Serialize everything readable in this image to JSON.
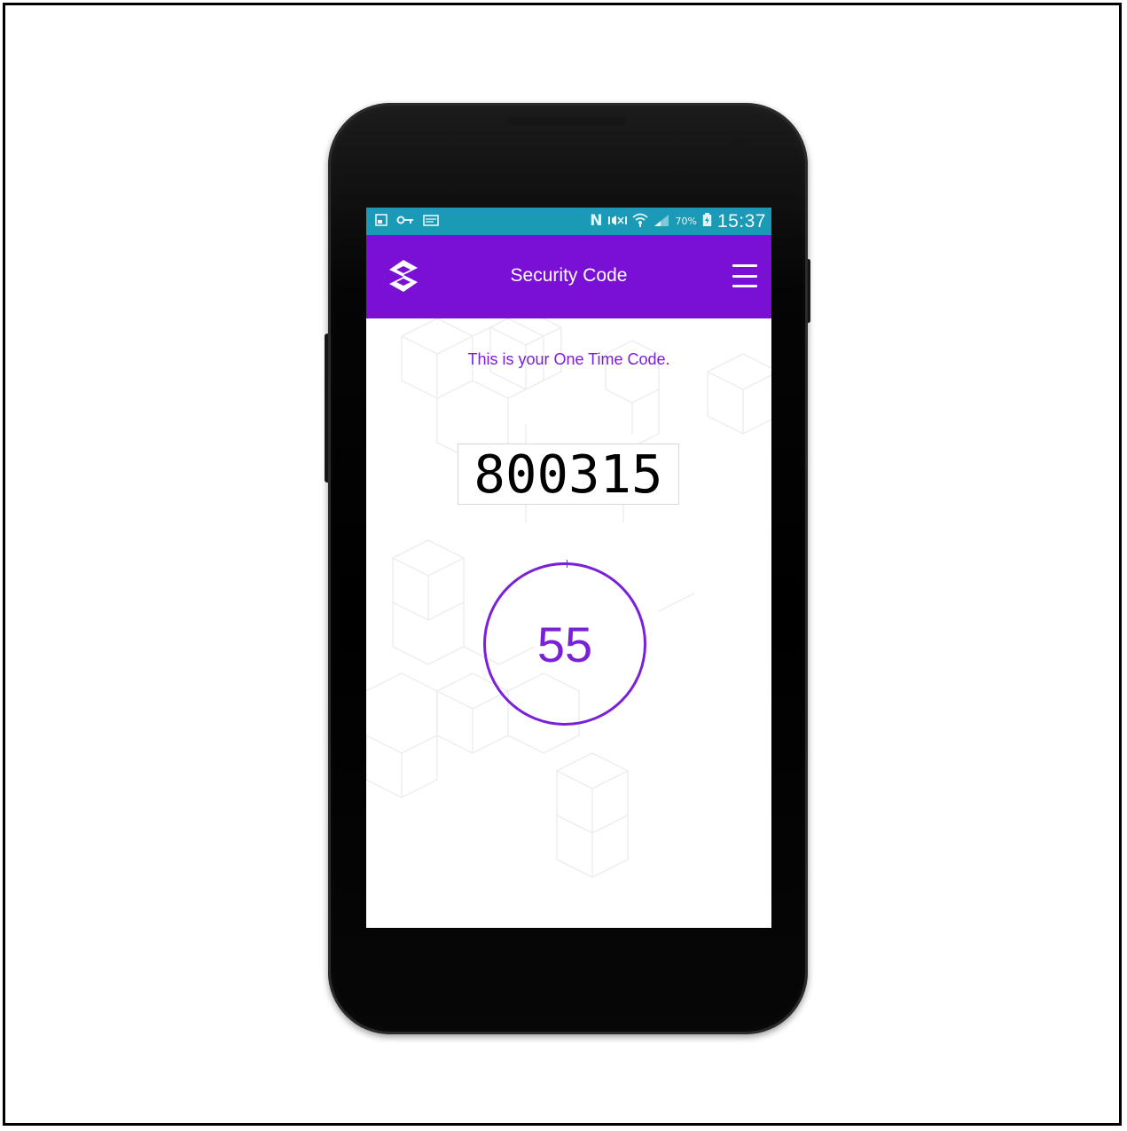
{
  "status_bar": {
    "icons": [
      "screenshot-icon",
      "vpn-key-icon",
      "mail-icon",
      "nfc-icon",
      "mute-icon",
      "wifi-icon",
      "signal-icon",
      "battery-icon"
    ],
    "battery": "70%",
    "time": "15:37"
  },
  "app_bar": {
    "title": "Security Code"
  },
  "otp": {
    "message": "This is your One Time Code.",
    "code": "800315",
    "seconds_remaining": "55"
  },
  "colors": {
    "status_bar": "#1a9ab5",
    "app_bar": "#7a0fd6",
    "accent": "#7a20d8"
  }
}
